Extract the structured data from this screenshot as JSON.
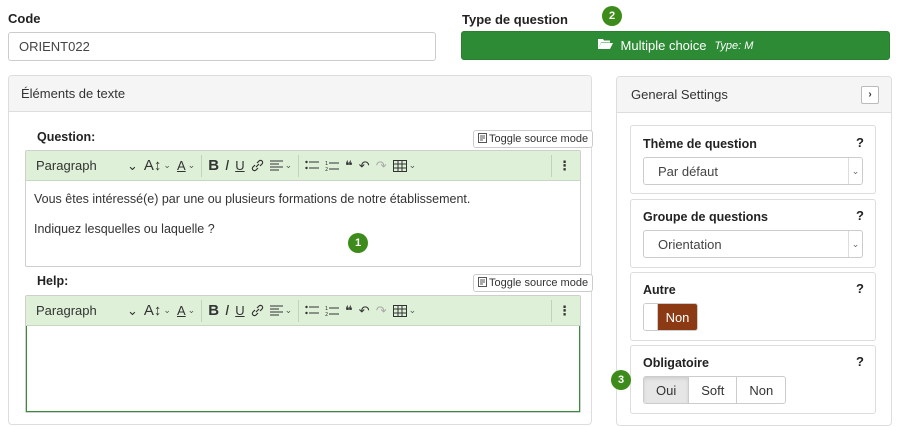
{
  "code": {
    "label": "Code",
    "value": "ORIENT022"
  },
  "type_of_question": {
    "label": "Type de question",
    "button_label": "Multiple choice",
    "button_sub": "Type: M",
    "badge": "2"
  },
  "text_panel": {
    "title": "Éléments de texte",
    "question": {
      "label": "Question:",
      "toggle_label": "Toggle source mode",
      "lines": [
        "Vous êtes intéressé(e) par une ou plusieurs formations de notre établissement.",
        "Indiquez lesquelles ou laquelle ?"
      ],
      "badge": "1"
    },
    "help": {
      "label": "Help:",
      "toggle_label": "Toggle source mode",
      "content": ""
    },
    "toolbar": {
      "paragraph": "Paragraph",
      "bold": "B",
      "italic": "I",
      "underline": "U",
      "quote": "❝"
    }
  },
  "settings": {
    "title": "General Settings",
    "theme": {
      "label": "Thème de question",
      "value": "Par défaut",
      "help": "?"
    },
    "group": {
      "label": "Groupe de questions",
      "value": "Orientation",
      "help": "?"
    },
    "other": {
      "label": "Autre",
      "state": "Non",
      "help": "?"
    },
    "mandatory": {
      "label": "Obligatoire",
      "help": "?",
      "options": [
        "Oui",
        "Soft",
        "Non"
      ],
      "selected": "Oui",
      "badge": "3"
    }
  },
  "colors": {
    "primary_green": "#2e8b35",
    "toolbar_green": "#dff0d8",
    "toggle_off": "#8b3a14",
    "badge_green": "#3d8c1b"
  },
  "icons": [
    "folder-open-icon",
    "chevron-right-icon",
    "link-icon",
    "undo-icon",
    "redo-icon",
    "table-icon",
    "more-icon"
  ]
}
